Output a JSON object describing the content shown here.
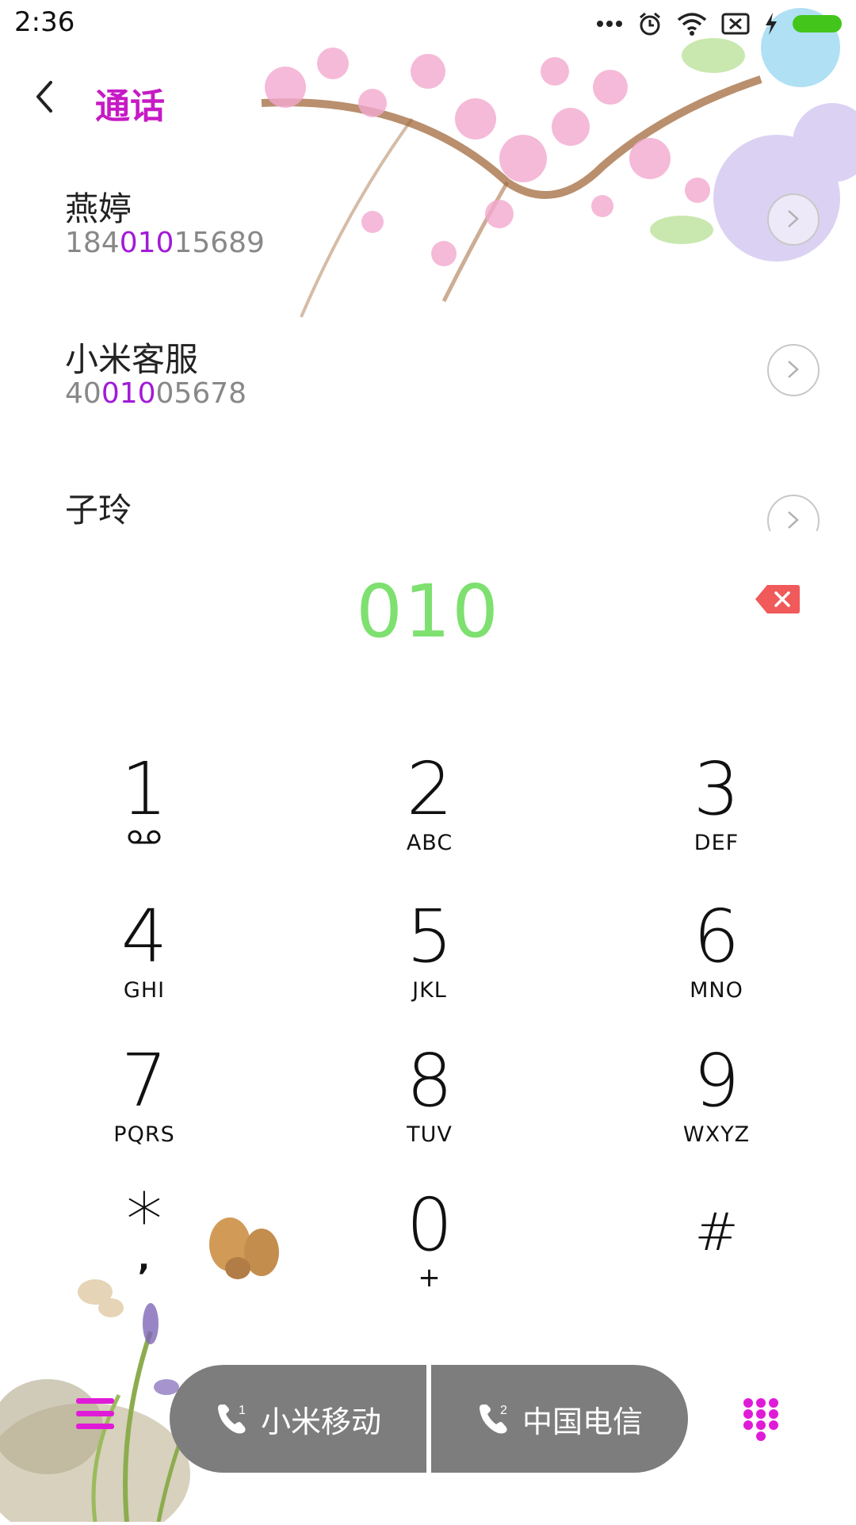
{
  "status_bar": {
    "time": "2:36",
    "icons": [
      "more-dots-icon",
      "alarm-icon",
      "wifi-icon",
      "sim-off-icon",
      "charging-icon",
      "battery-icon"
    ],
    "battery_color": "#43c51b"
  },
  "header": {
    "back_icon": "chevron-left-icon",
    "title": "通话",
    "title_color": "#c61ac5"
  },
  "contacts": [
    {
      "name": "燕婷",
      "number_prefix": "184",
      "number_match": "010",
      "number_suffix": "15689"
    },
    {
      "name": "小米客服",
      "number_prefix": "40",
      "number_match": "010",
      "number_suffix": "05678"
    },
    {
      "name": "子玲",
      "number_prefix": "",
      "number_match": "",
      "number_suffix": ""
    }
  ],
  "dialer": {
    "input": "010",
    "input_color": "#7de06f",
    "backspace_icon": "backspace-icon",
    "keys": [
      {
        "digit": "1",
        "letters": ""
      },
      {
        "digit": "2",
        "letters": "ABC"
      },
      {
        "digit": "3",
        "letters": "DEF"
      },
      {
        "digit": "4",
        "letters": "GHI"
      },
      {
        "digit": "5",
        "letters": "JKL"
      },
      {
        "digit": "6",
        "letters": "MNO"
      },
      {
        "digit": "7",
        "letters": "PQRS"
      },
      {
        "digit": "8",
        "letters": "TUV"
      },
      {
        "digit": "9",
        "letters": "WXYZ"
      },
      {
        "digit": "*",
        "letters": ","
      },
      {
        "digit": "0",
        "letters": "+"
      },
      {
        "digit": "#",
        "letters": ""
      }
    ]
  },
  "bottom_bar": {
    "menu_icon": "menu-icon",
    "sim1_label": "小米移动",
    "sim1_badge": "1",
    "sim2_label": "中国电信",
    "sim2_badge": "2",
    "dialpad_icon": "dialpad-icon",
    "accent_color": "#e01bd8"
  }
}
